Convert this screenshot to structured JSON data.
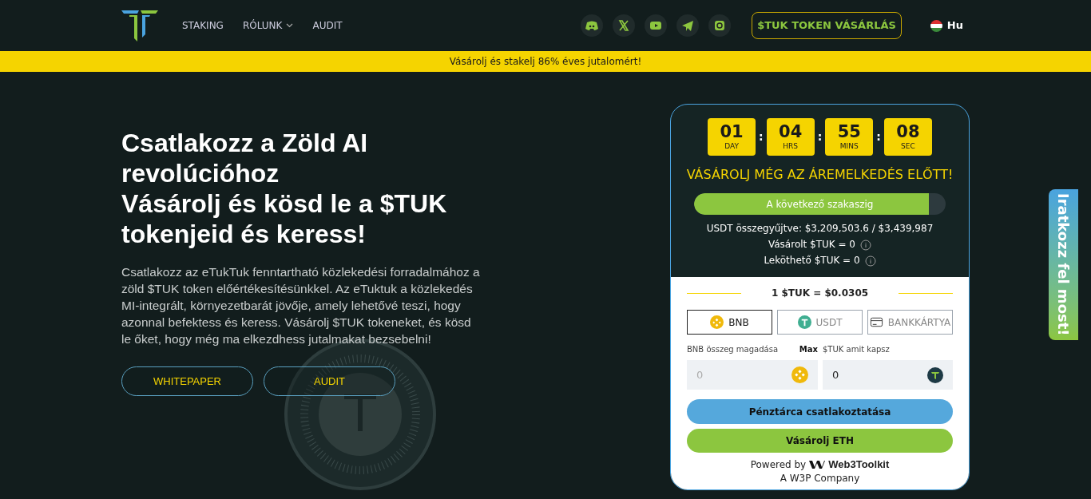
{
  "nav": {
    "items": [
      {
        "label": "STAKING",
        "dropdown": false
      },
      {
        "label": "RÓLUNK",
        "dropdown": true
      },
      {
        "label": "AUDIT",
        "dropdown": false
      }
    ],
    "socials": [
      {
        "kind": "discord"
      },
      {
        "kind": "x"
      },
      {
        "kind": "youtube"
      },
      {
        "kind": "telegram"
      },
      {
        "kind": "instagram"
      }
    ],
    "buy_button": "$TUK TOKEN VÁSÁRLÁS",
    "language": "Hu"
  },
  "banner": "Vásárolj és stakelj 86% éves jutalomért!",
  "hero": {
    "title_lines": [
      "Csatlakozz a  Zöld AI revolúcióhoz",
      "Vásárolj és kösd le a $TUK tokenjeid és keress!"
    ],
    "description": "Csatlakozz az eTukTuk fenntartható közlekedési forradalmához a zöld $TUK token előértékesítésünkkel. Az eTuktuk a közlekedés MI-integrált, környezetbarát jövője, amely lehetővé teszi, hogy azonnal befektess és keress. Vásárolj $TUK tokeneket, és kösd le őket, hogy még ma elkezdhess jutalmakat bezsebelni!",
    "buttons": [
      "WHITEPAPER",
      "AUDIT"
    ]
  },
  "widget": {
    "countdown": [
      {
        "value": "01",
        "unit": "DAY"
      },
      {
        "value": "04",
        "unit": "HRS"
      },
      {
        "value": "55",
        "unit": "MINS"
      },
      {
        "value": "08",
        "unit": "SEC"
      }
    ],
    "separator": ":",
    "headline": "VÁSÁROLJ MÉG AZ ÁREMELKEDÉS ELŐTT!",
    "progress": {
      "label": "A következő szakaszig",
      "level": 0.933
    },
    "stats": [
      {
        "text": "USDT összegyűjtve: $3,209,503.6 / $3,439,987",
        "info": false
      },
      {
        "text": "Vásárolt $TUK = 0",
        "info": true
      },
      {
        "text": "Leköthető $TUK = 0",
        "info": true
      }
    ],
    "price": "1 $TUK = $0.0305",
    "methods": [
      {
        "kind": "bnb",
        "label": "BNB",
        "selected": true
      },
      {
        "kind": "usdt",
        "label": "USDT",
        "selected": false
      },
      {
        "kind": "card",
        "label": "BANKKÁRTYA",
        "selected": false
      }
    ],
    "pay_label": "BNB összeg magadása",
    "max": "Max",
    "receive_label": "$TUK amit kapsz",
    "pay_placeholder": "0",
    "receive_value": "0",
    "connect_button": "Pénztárca csatlakoztatása",
    "buy_button": "Vásárolj ETH",
    "powered_by": "Powered by",
    "brand": "Web3Toolkit",
    "company": "A W3P Company"
  },
  "side_tab": "Iratkozz fel most!"
}
